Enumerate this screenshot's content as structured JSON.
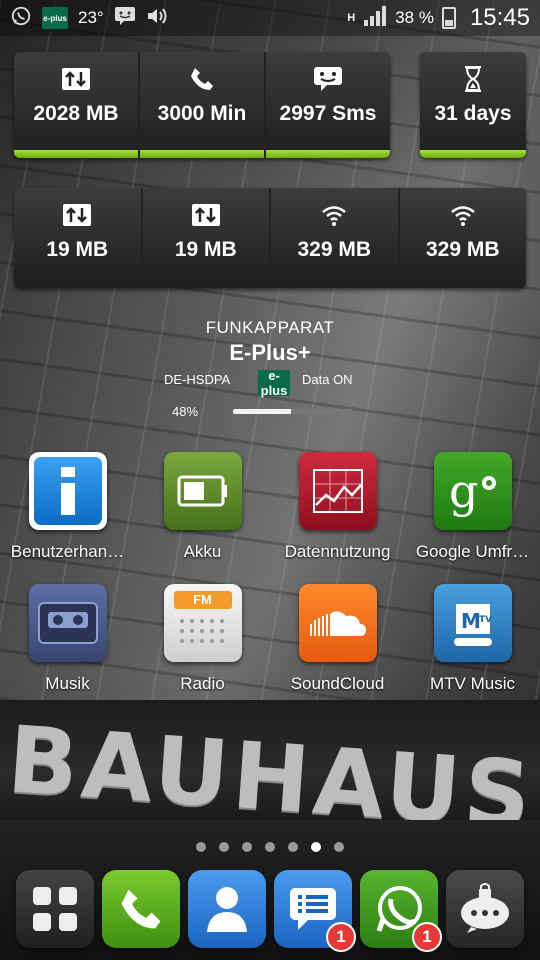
{
  "status_bar": {
    "temperature": "23°",
    "network_type": "H",
    "battery": "38 %",
    "time": "15:45",
    "icons": [
      "whatsapp-icon",
      "eplus-icon",
      "bbm-icon",
      "volume-icon",
      "signal-icon",
      "battery-icon"
    ]
  },
  "widget": {
    "row1": [
      {
        "icon": "data-transfer-icon",
        "value": "2028 MB"
      },
      {
        "icon": "phone-icon",
        "value": "3000 Min"
      },
      {
        "icon": "sms-icon",
        "value": "2997 Sms"
      }
    ],
    "row1_days": {
      "icon": "hourglass-icon",
      "value": "31 days"
    },
    "row2": [
      {
        "icon": "data-transfer-icon",
        "value": "19 MB"
      },
      {
        "icon": "data-transfer-icon",
        "value": "19 MB"
      },
      {
        "icon": "wifi-icon",
        "value": "329 MB"
      },
      {
        "icon": "wifi-icon",
        "value": "329 MB"
      }
    ]
  },
  "radio": {
    "title": "FUNKAPPARAT",
    "operator": "E-Plus+",
    "network": "DE-HSDPA",
    "data_status": "Data ON",
    "percent_label": "48%",
    "percent": 48,
    "logo_text": "e-plus"
  },
  "apps": [
    {
      "label": "Benutzerhan…",
      "icon": "info-icon",
      "color": "#1e88e5"
    },
    {
      "label": "Akku",
      "icon": "battery-app-icon",
      "color": "#5b8a2a"
    },
    {
      "label": "Datennutzung",
      "icon": "chart-app-icon",
      "color": "#b0152b"
    },
    {
      "label": "Google Umfr…",
      "icon": "google-surveys-icon",
      "color": "#2e8b1e"
    },
    {
      "label": "Musik",
      "icon": "cassette-icon",
      "color": "#4a5a8a"
    },
    {
      "label": "Radio",
      "icon": "radio-icon",
      "color": "#e6e6e6"
    },
    {
      "label": "SoundCloud",
      "icon": "soundcloud-icon",
      "color": "#f26f1f"
    },
    {
      "label": "MTV Music",
      "icon": "mtv-icon",
      "color": "#2c7fc0"
    }
  ],
  "radio_app_fm": "FM",
  "page_dots": {
    "count": 7,
    "active": 5
  },
  "dock": [
    {
      "icon": "apps-grid-icon",
      "color": "#333333",
      "badge": ""
    },
    {
      "icon": "phone-icon",
      "color": "#4caf1a",
      "badge": ""
    },
    {
      "icon": "contacts-icon",
      "color": "#2a7ad2",
      "badge": ""
    },
    {
      "icon": "messages-icon",
      "color": "#2a7ad2",
      "badge": "1"
    },
    {
      "icon": "whatsapp-icon",
      "color": "#3a9a1e",
      "badge": "1"
    },
    {
      "icon": "lock-chat-icon",
      "color": "#3a3a3a",
      "badge": ""
    }
  ],
  "wallpaper_sign": "BAUHAUS",
  "colors": {
    "accent_green": "#8cc63f",
    "badge_red": "#e53935"
  }
}
